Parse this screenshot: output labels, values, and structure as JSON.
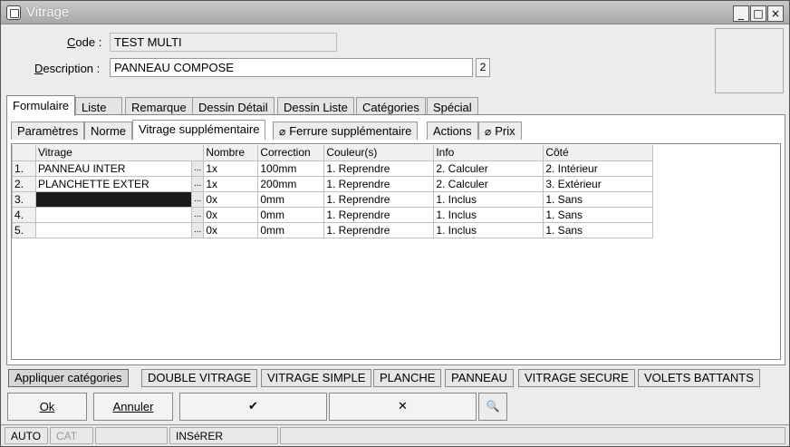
{
  "window": {
    "title": "Vitrage",
    "buttons": [
      "_",
      "□",
      "×"
    ]
  },
  "form": {
    "code_label_prefix": "C",
    "code_label_rest": "ode :",
    "code_value": "TEST MULTI",
    "desc_label_prefix": "D",
    "desc_label_rest": "escription :",
    "desc_value": "PANNEAU COMPOSE",
    "desc_count": "2"
  },
  "tabs": [
    "Formulaire",
    "Liste",
    "Remarque",
    "Dessin Détail",
    "Dessin Liste",
    "Catégories",
    "Spécial"
  ],
  "subtabs": {
    "t0": "Paramètres",
    "t1": "Norme",
    "t2": "Vitrage supplémentaire",
    "t3": "Ferrure supplémentaire",
    "t4": "Actions",
    "t5": "Prix"
  },
  "grid": {
    "headers": [
      "Vitrage",
      "Nombre",
      "Correction",
      "Couleur(s)",
      "Info",
      "Côté"
    ],
    "rows": [
      {
        "n": "1.",
        "vitrage": "PANNEAU INTER",
        "nombre": "1x",
        "correction": "100mm",
        "couleur": "1. Reprendre",
        "info": "2. Calculer",
        "cote": "2. Intérieur"
      },
      {
        "n": "2.",
        "vitrage": "PLANCHETTE EXTER",
        "nombre": "1x",
        "correction": "200mm",
        "couleur": "1. Reprendre",
        "info": "2. Calculer",
        "cote": "3. Extérieur"
      },
      {
        "n": "3.",
        "vitrage": "",
        "nombre": "0x",
        "correction": "0mm",
        "couleur": "1. Reprendre",
        "info": "1. Inclus",
        "cote": "1. Sans"
      },
      {
        "n": "4.",
        "vitrage": "",
        "nombre": "0x",
        "correction": "0mm",
        "couleur": "1. Reprendre",
        "info": "1. Inclus",
        "cote": "1. Sans"
      },
      {
        "n": "5.",
        "vitrage": "",
        "nombre": "0x",
        "correction": "0mm",
        "couleur": "1. Reprendre",
        "info": "1. Inclus",
        "cote": "1. Sans"
      }
    ],
    "dots": "..."
  },
  "categories": [
    "Appliquer catégories",
    "DOUBLE VITRAGE",
    "VITRAGE SIMPLE",
    "PLANCHE",
    "PANNEAU",
    "VITRAGE SECURE",
    "VOLETS BATTANTS"
  ],
  "actions": {
    "ok": "Ok",
    "annuler": "Annuler",
    "check": "✔",
    "cross": "✕",
    "find": "🔍"
  },
  "status": {
    "mode": "AUTO",
    "cat": "CAT",
    "insert": "INSéRER"
  }
}
